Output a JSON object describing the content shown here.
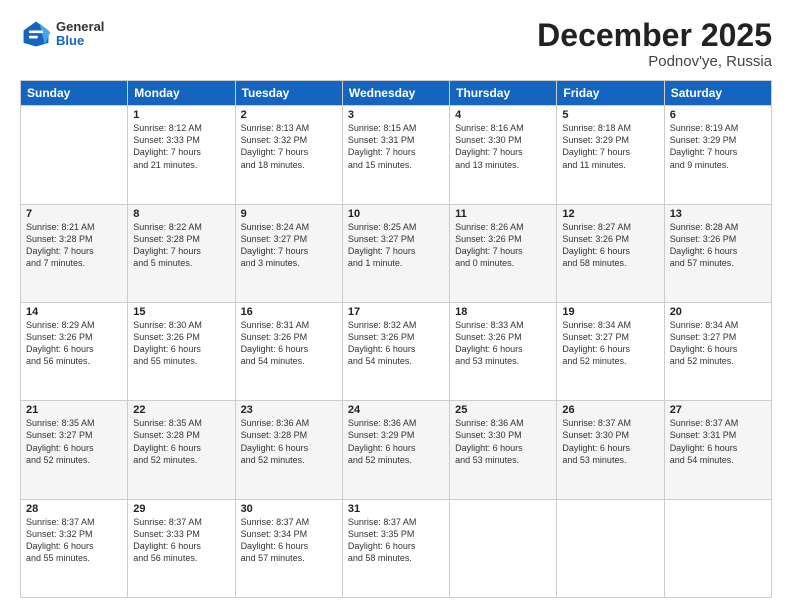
{
  "logo": {
    "general": "General",
    "blue": "Blue"
  },
  "header": {
    "title": "December 2025",
    "subtitle": "Podnov'ye, Russia"
  },
  "weekdays": [
    "Sunday",
    "Monday",
    "Tuesday",
    "Wednesday",
    "Thursday",
    "Friday",
    "Saturday"
  ],
  "weeks": [
    [
      {
        "day": "",
        "info": ""
      },
      {
        "day": "1",
        "info": "Sunrise: 8:12 AM\nSunset: 3:33 PM\nDaylight: 7 hours\nand 21 minutes."
      },
      {
        "day": "2",
        "info": "Sunrise: 8:13 AM\nSunset: 3:32 PM\nDaylight: 7 hours\nand 18 minutes."
      },
      {
        "day": "3",
        "info": "Sunrise: 8:15 AM\nSunset: 3:31 PM\nDaylight: 7 hours\nand 15 minutes."
      },
      {
        "day": "4",
        "info": "Sunrise: 8:16 AM\nSunset: 3:30 PM\nDaylight: 7 hours\nand 13 minutes."
      },
      {
        "day": "5",
        "info": "Sunrise: 8:18 AM\nSunset: 3:29 PM\nDaylight: 7 hours\nand 11 minutes."
      },
      {
        "day": "6",
        "info": "Sunrise: 8:19 AM\nSunset: 3:29 PM\nDaylight: 7 hours\nand 9 minutes."
      }
    ],
    [
      {
        "day": "7",
        "info": "Sunrise: 8:21 AM\nSunset: 3:28 PM\nDaylight: 7 hours\nand 7 minutes."
      },
      {
        "day": "8",
        "info": "Sunrise: 8:22 AM\nSunset: 3:28 PM\nDaylight: 7 hours\nand 5 minutes."
      },
      {
        "day": "9",
        "info": "Sunrise: 8:24 AM\nSunset: 3:27 PM\nDaylight: 7 hours\nand 3 minutes."
      },
      {
        "day": "10",
        "info": "Sunrise: 8:25 AM\nSunset: 3:27 PM\nDaylight: 7 hours\nand 1 minute."
      },
      {
        "day": "11",
        "info": "Sunrise: 8:26 AM\nSunset: 3:26 PM\nDaylight: 7 hours\nand 0 minutes."
      },
      {
        "day": "12",
        "info": "Sunrise: 8:27 AM\nSunset: 3:26 PM\nDaylight: 6 hours\nand 58 minutes."
      },
      {
        "day": "13",
        "info": "Sunrise: 8:28 AM\nSunset: 3:26 PM\nDaylight: 6 hours\nand 57 minutes."
      }
    ],
    [
      {
        "day": "14",
        "info": "Sunrise: 8:29 AM\nSunset: 3:26 PM\nDaylight: 6 hours\nand 56 minutes."
      },
      {
        "day": "15",
        "info": "Sunrise: 8:30 AM\nSunset: 3:26 PM\nDaylight: 6 hours\nand 55 minutes."
      },
      {
        "day": "16",
        "info": "Sunrise: 8:31 AM\nSunset: 3:26 PM\nDaylight: 6 hours\nand 54 minutes."
      },
      {
        "day": "17",
        "info": "Sunrise: 8:32 AM\nSunset: 3:26 PM\nDaylight: 6 hours\nand 54 minutes."
      },
      {
        "day": "18",
        "info": "Sunrise: 8:33 AM\nSunset: 3:26 PM\nDaylight: 6 hours\nand 53 minutes."
      },
      {
        "day": "19",
        "info": "Sunrise: 8:34 AM\nSunset: 3:27 PM\nDaylight: 6 hours\nand 52 minutes."
      },
      {
        "day": "20",
        "info": "Sunrise: 8:34 AM\nSunset: 3:27 PM\nDaylight: 6 hours\nand 52 minutes."
      }
    ],
    [
      {
        "day": "21",
        "info": "Sunrise: 8:35 AM\nSunset: 3:27 PM\nDaylight: 6 hours\nand 52 minutes."
      },
      {
        "day": "22",
        "info": "Sunrise: 8:35 AM\nSunset: 3:28 PM\nDaylight: 6 hours\nand 52 minutes."
      },
      {
        "day": "23",
        "info": "Sunrise: 8:36 AM\nSunset: 3:28 PM\nDaylight: 6 hours\nand 52 minutes."
      },
      {
        "day": "24",
        "info": "Sunrise: 8:36 AM\nSunset: 3:29 PM\nDaylight: 6 hours\nand 52 minutes."
      },
      {
        "day": "25",
        "info": "Sunrise: 8:36 AM\nSunset: 3:30 PM\nDaylight: 6 hours\nand 53 minutes."
      },
      {
        "day": "26",
        "info": "Sunrise: 8:37 AM\nSunset: 3:30 PM\nDaylight: 6 hours\nand 53 minutes."
      },
      {
        "day": "27",
        "info": "Sunrise: 8:37 AM\nSunset: 3:31 PM\nDaylight: 6 hours\nand 54 minutes."
      }
    ],
    [
      {
        "day": "28",
        "info": "Sunrise: 8:37 AM\nSunset: 3:32 PM\nDaylight: 6 hours\nand 55 minutes."
      },
      {
        "day": "29",
        "info": "Sunrise: 8:37 AM\nSunset: 3:33 PM\nDaylight: 6 hours\nand 56 minutes."
      },
      {
        "day": "30",
        "info": "Sunrise: 8:37 AM\nSunset: 3:34 PM\nDaylight: 6 hours\nand 57 minutes."
      },
      {
        "day": "31",
        "info": "Sunrise: 8:37 AM\nSunset: 3:35 PM\nDaylight: 6 hours\nand 58 minutes."
      },
      {
        "day": "",
        "info": ""
      },
      {
        "day": "",
        "info": ""
      },
      {
        "day": "",
        "info": ""
      }
    ]
  ]
}
